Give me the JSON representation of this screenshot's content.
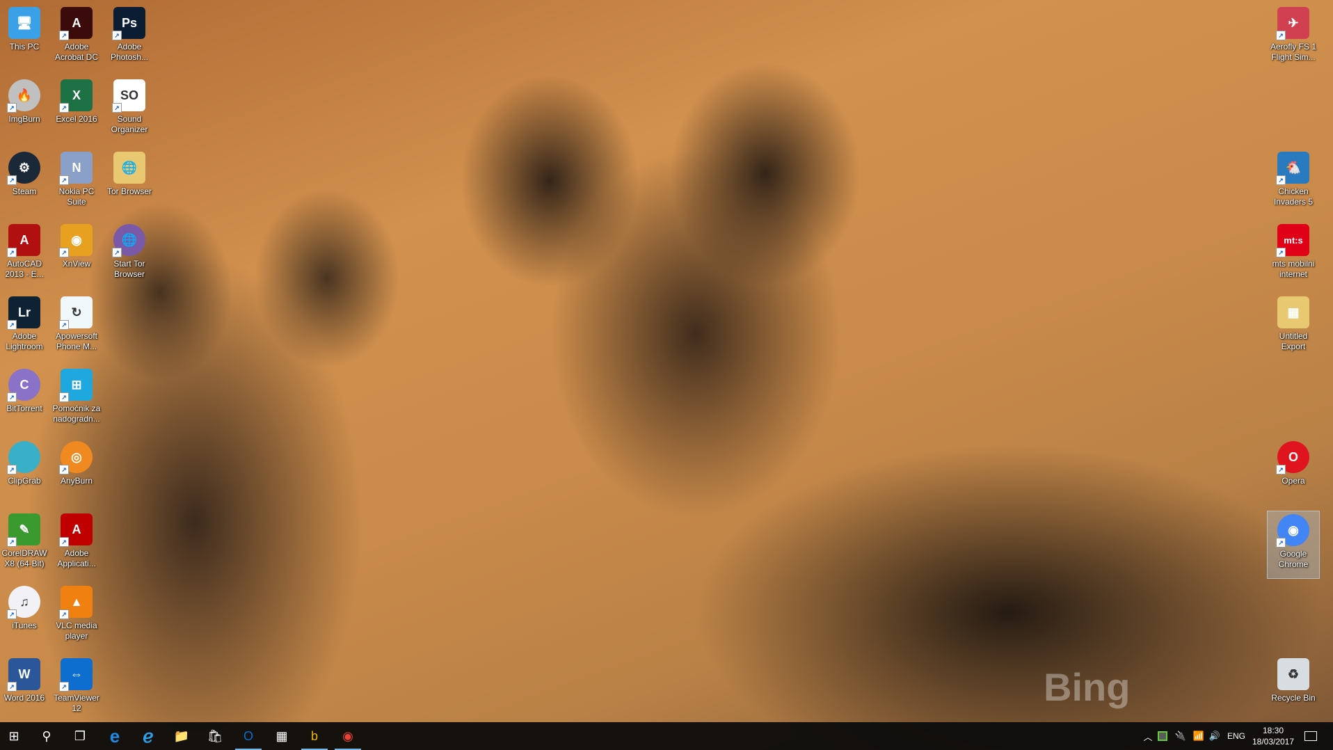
{
  "desktop": {
    "icons": [
      {
        "label": "This PC",
        "icon": "computer-icon",
        "color": "#3aa0e8",
        "glyph": "🖥",
        "shortcut": false
      },
      {
        "label": "Adobe Acrobat DC",
        "icon": "acrobat-icon",
        "color": "#3b0a0a",
        "glyph": "A",
        "shortcut": true
      },
      {
        "label": "Adobe Photosh...",
        "icon": "photoshop-icon",
        "color": "#0b1d33",
        "glyph": "Ps",
        "shortcut": true
      },
      {
        "label": "ImgBurn",
        "icon": "imgburn-icon",
        "color": "#c0c0c0",
        "glyph": "🔥",
        "shortcut": true
      },
      {
        "label": "Excel 2016",
        "icon": "excel-icon",
        "color": "#1e7145",
        "glyph": "X",
        "shortcut": true
      },
      {
        "label": "Sound Organizer",
        "icon": "sound-organizer-icon",
        "color": "#ffffff",
        "glyph": "SO",
        "shortcut": true
      },
      {
        "label": "Steam",
        "icon": "steam-icon",
        "color": "#1b2838",
        "glyph": "⚙",
        "shortcut": true
      },
      {
        "label": "Nokia PC Suite",
        "icon": "nokia-pc-suite-icon",
        "color": "#8aa0c8",
        "glyph": "N",
        "shortcut": true
      },
      {
        "label": "Tor Browser",
        "icon": "folder-icon",
        "color": "#e8c870",
        "glyph": "🌐",
        "shortcut": false
      },
      {
        "label": "AutoCAD 2013 - E...",
        "icon": "autocad-icon",
        "color": "#b01010",
        "glyph": "A",
        "shortcut": true
      },
      {
        "label": "XnView",
        "icon": "xnview-icon",
        "color": "#e8a020",
        "glyph": "◉",
        "shortcut": true
      },
      {
        "label": "Start Tor Browser",
        "icon": "tor-icon",
        "color": "#7a5aa8",
        "glyph": "🌐",
        "shortcut": true
      },
      {
        "label": "Adobe Lightroom",
        "icon": "lightroom-icon",
        "color": "#0e2233",
        "glyph": "Lr",
        "shortcut": true
      },
      {
        "label": "Apowersoft Phone M...",
        "icon": "apowersoft-icon",
        "color": "#f0f8fa",
        "glyph": "↻",
        "shortcut": true
      },
      {
        "label": "BitTorrent",
        "icon": "bittorrent-icon",
        "color": "#8a72c8",
        "glyph": "C",
        "shortcut": true
      },
      {
        "label": "Pomoćnik za nadogradn...",
        "icon": "windows-upgrade-icon",
        "color": "#1fa8e0",
        "glyph": "⊞",
        "shortcut": true
      },
      {
        "label": "ClipGrab",
        "icon": "clipgrab-icon",
        "color": "#3ab0c8",
        "glyph": "",
        "shortcut": true
      },
      {
        "label": "AnyBurn",
        "icon": "anyburn-icon",
        "color": "#f08a20",
        "glyph": "◎",
        "shortcut": true
      },
      {
        "label": "CorelDRAW X8 (64-Bit)",
        "icon": "coreldraw-icon",
        "color": "#3a9a30",
        "glyph": "✎",
        "shortcut": true
      },
      {
        "label": "Adobe Applicati...",
        "icon": "adobe-app-manager-icon",
        "color": "#c00000",
        "glyph": "A",
        "shortcut": true
      },
      {
        "label": "iTunes",
        "icon": "itunes-icon",
        "color": "#f2f2f6",
        "glyph": "♫",
        "shortcut": true
      },
      {
        "label": "VLC media player",
        "icon": "vlc-icon",
        "color": "#f08010",
        "glyph": "▲",
        "shortcut": true
      },
      {
        "label": "Word 2016",
        "icon": "word-icon",
        "color": "#2b579a",
        "glyph": "W",
        "shortcut": true
      },
      {
        "label": "TeamViewer 12",
        "icon": "teamviewer-icon",
        "color": "#0e6ed0",
        "glyph": "⇔",
        "shortcut": true
      },
      {
        "label": "Aerofly FS 1 Flight Sim...",
        "icon": "aerofly-icon",
        "color": "#d04050",
        "glyph": "✈",
        "shortcut": true
      },
      {
        "label": "Chicken Invaders 5",
        "icon": "chicken-invaders-icon",
        "color": "#2a7ac0",
        "glyph": "🐔",
        "shortcut": true
      },
      {
        "label": "mts mobilni internet",
        "icon": "mts-icon",
        "color": "#e00018",
        "glyph": "mt:s",
        "shortcut": true
      },
      {
        "label": "Untitled Export",
        "icon": "folder-icon",
        "color": "#e8c870",
        "glyph": "▦",
        "shortcut": false
      },
      {
        "label": "Opera",
        "icon": "opera-icon",
        "color": "#e0141e",
        "glyph": "O",
        "shortcut": true
      },
      {
        "label": "Google Chrome",
        "icon": "chrome-icon",
        "color": "#4285f4",
        "glyph": "◉",
        "shortcut": true
      },
      {
        "label": "Recycle Bin",
        "icon": "recycle-bin-icon",
        "color": "#d8dde2",
        "glyph": "♻",
        "shortcut": false
      }
    ],
    "selected": "Google Chrome",
    "watermark": "Bing"
  },
  "taskbar": {
    "items": [
      {
        "name": "start-button",
        "icon": "windows-icon",
        "glyph": "⊞",
        "running": false
      },
      {
        "name": "search-button",
        "icon": "search-icon",
        "glyph": "⚲",
        "running": false
      },
      {
        "name": "task-view-button",
        "icon": "task-view-icon",
        "glyph": "❐",
        "running": false
      },
      {
        "name": "edge-button",
        "icon": "edge-icon",
        "glyph": "e",
        "running": false
      },
      {
        "name": "internet-explorer-button",
        "icon": "internet-explorer-icon",
        "glyph": "ℯ",
        "running": false
      },
      {
        "name": "file-explorer-button",
        "icon": "folder-icon",
        "glyph": "📁",
        "running": false
      },
      {
        "name": "store-button",
        "icon": "store-icon",
        "glyph": "🛍",
        "running": false
      },
      {
        "name": "outlook-button",
        "icon": "outlook-icon",
        "glyph": "O",
        "running": true
      },
      {
        "name": "calculator-button",
        "icon": "calculator-icon",
        "glyph": "▦",
        "running": false
      },
      {
        "name": "bing-wallpaper-button",
        "icon": "bing-icon",
        "glyph": "b",
        "running": true
      },
      {
        "name": "chrome-button",
        "icon": "chrome-icon",
        "glyph": "◉",
        "running": true
      }
    ],
    "tray": {
      "language": "ENG",
      "time": "18:30",
      "date": "18/03/2017"
    }
  }
}
